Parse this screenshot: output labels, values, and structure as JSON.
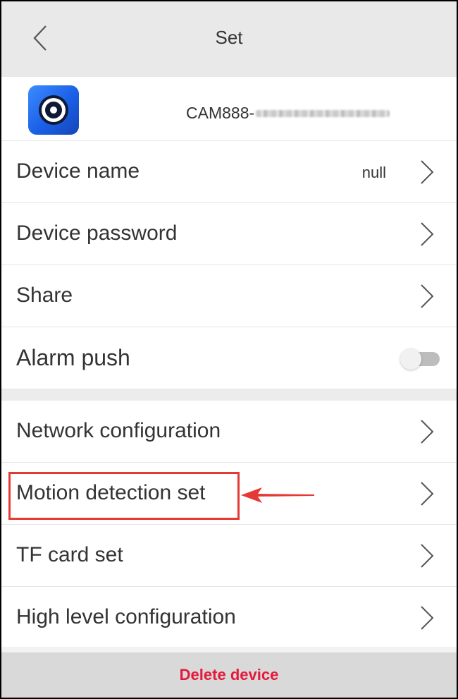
{
  "header": {
    "title": "Set",
    "back_icon": "chevron-left-icon"
  },
  "device": {
    "app_icon": "camera-eye-icon",
    "id_prefix": "CAM888-",
    "id_redacted": true
  },
  "settings_group_1": {
    "device_name": {
      "label": "Device name",
      "value": "null"
    },
    "device_password": {
      "label": "Device password"
    },
    "share": {
      "label": "Share"
    },
    "alarm_push": {
      "label": "Alarm push",
      "toggle_on": false
    }
  },
  "settings_group_2": {
    "network_configuration": {
      "label": "Network configuration"
    },
    "motion_detection_set": {
      "label": "Motion detection set",
      "highlighted": true
    },
    "tf_card_set": {
      "label": "TF card set"
    },
    "high_level_configuration": {
      "label": "High level configuration"
    }
  },
  "footer": {
    "delete_label": "Delete device"
  },
  "colors": {
    "header_bg": "#e9e9e9",
    "highlight": "#e53935",
    "delete_text": "#e5193a",
    "delete_bg": "#d9d9d9",
    "app_icon_blue": "#1a5fe6"
  }
}
